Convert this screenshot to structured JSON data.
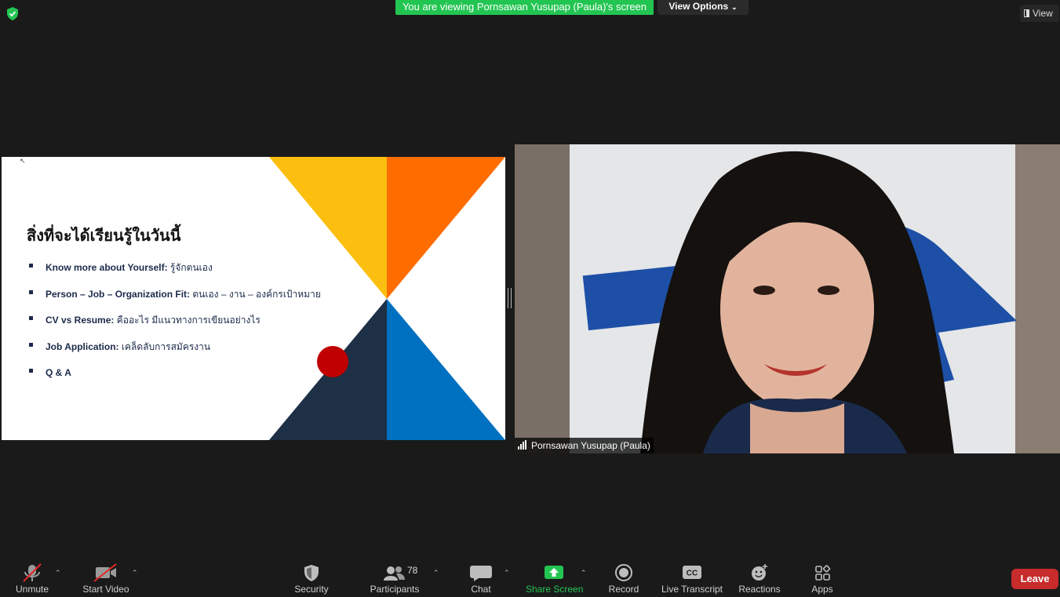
{
  "header": {
    "banner_text": "You are viewing Pornsawan Yusupap (Paula)'s screen",
    "view_options_label": "View Options",
    "view_label": "View"
  },
  "slide": {
    "title": "สิ่งที่จะได้เรียนรู้ในวันนี้",
    "bullets": [
      {
        "en": "Know more about Yourself:",
        "th": " รู้จักตนเอง"
      },
      {
        "en": "Person – Job – Organization Fit:",
        "th": " ตนเอง – งาน – องค์กรเป้าหมาย"
      },
      {
        "en": "CV vs Resume:",
        "th": " คืออะไร มีแนวทางการเขียนอย่างไร"
      },
      {
        "en": "Job Application:",
        "th": " เคล็ดลับการสมัครงาน"
      },
      {
        "en": "Q & A",
        "th": ""
      }
    ],
    "colors": {
      "yellow": "#fcbf0f",
      "orange": "#ff6c00",
      "navy": "#1d3045",
      "blue": "#0070c0",
      "red_dot": "#c00000"
    }
  },
  "video": {
    "participant_name": "Pornsawan Yusupap (Paula)"
  },
  "toolbar": {
    "unmute": "Unmute",
    "start_video": "Start Video",
    "security": "Security",
    "participants": "Participants",
    "participants_count": "78",
    "chat": "Chat",
    "share_screen": "Share Screen",
    "record": "Record",
    "live_transcript": "Live Transcript",
    "reactions": "Reactions",
    "apps": "Apps",
    "leave": "Leave",
    "share_color": "#23c552",
    "leave_color": "#c72b2b"
  }
}
